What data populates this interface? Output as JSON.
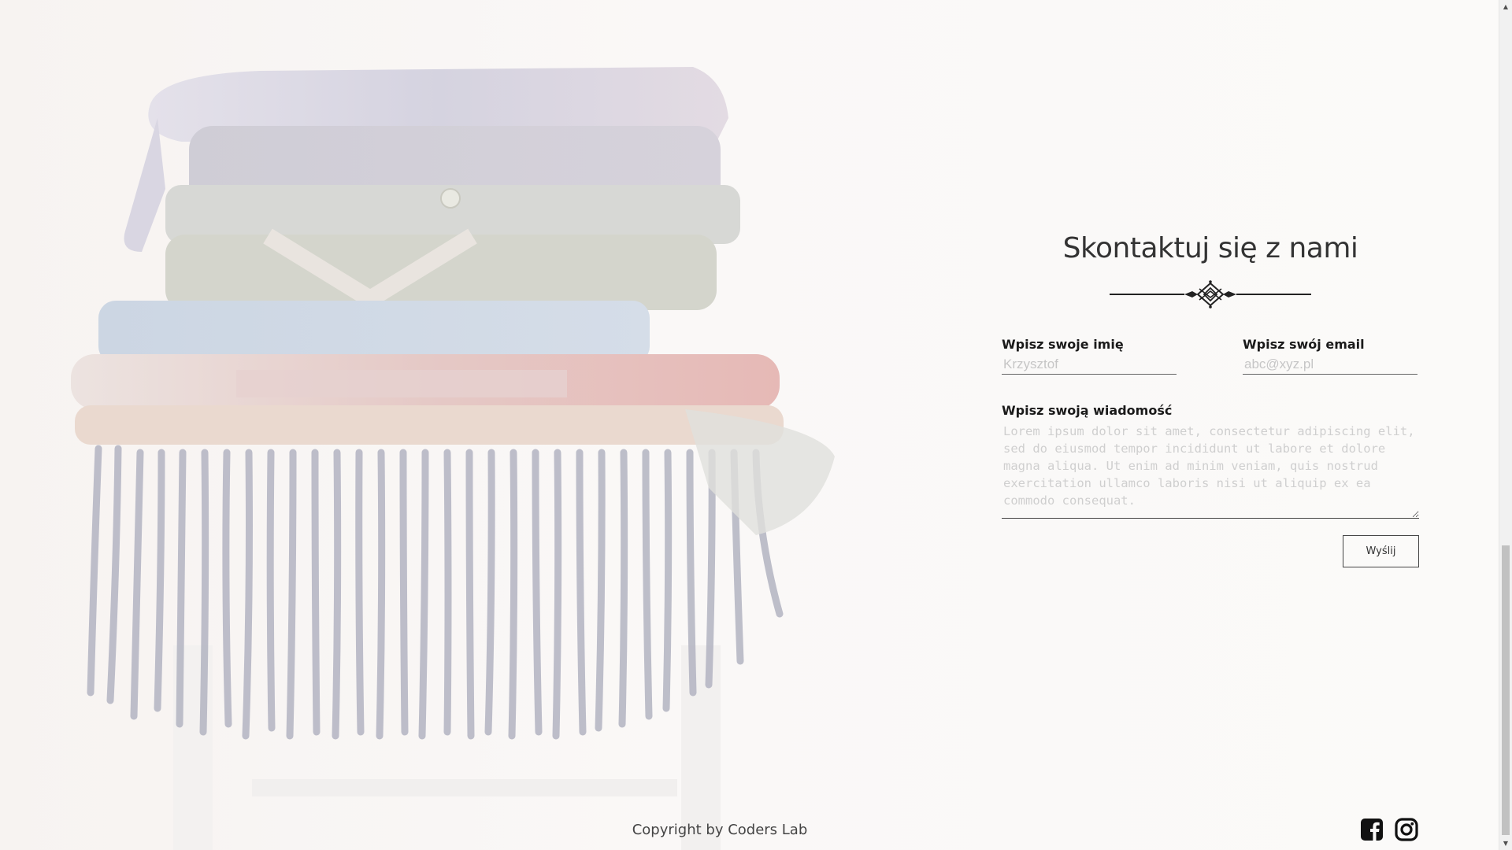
{
  "contact": {
    "title": "Skontaktuj się z nami",
    "name_label": "Wpisz swoje imię",
    "name_placeholder": "Krzysztof",
    "email_label": "Wpisz swój email",
    "email_placeholder": "abc@xyz.pl",
    "message_label": "Wpisz swoją wiadomość",
    "message_placeholder": "Lorem ipsum dolor sit amet, consectetur adipiscing elit, sed do eiusmod tempor incididunt ut labore et dolore magna aliqua. Ut enim ad minim veniam, quis nostrud exercitation ullamco laboris nisi ut aliquip ex ea commodo consequat.",
    "send_label": "Wyślij"
  },
  "footer": {
    "copyright": "Copyright by Coders Lab"
  },
  "social": {
    "facebook_icon": "facebook-icon",
    "instagram_icon": "instagram-icon"
  },
  "scrollbar": {
    "up_glyph": "▲",
    "down_glyph": "▼"
  },
  "colors": {
    "text": "#333333",
    "label": "#1a1a1a",
    "placeholder": "#c6c6c6",
    "background": "#faf8f7"
  }
}
